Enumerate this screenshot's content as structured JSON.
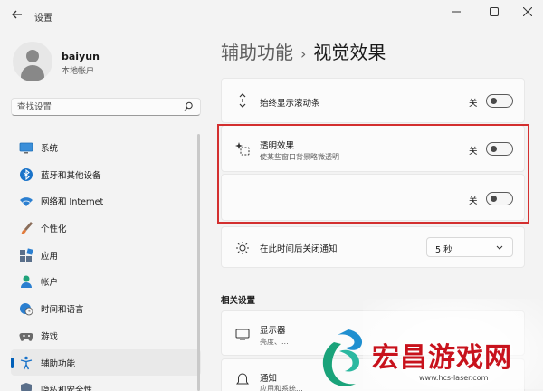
{
  "window": {
    "title": "设置",
    "back_icon": "back-arrow-icon",
    "controls": [
      "minimize-icon",
      "maximize-icon",
      "close-icon"
    ]
  },
  "profile": {
    "name": "baiyun",
    "account_type": "本地帐户"
  },
  "search": {
    "placeholder": "查找设置",
    "value": ""
  },
  "sidebar": {
    "items": [
      {
        "label": "系统",
        "icon": "monitor-icon",
        "active": false
      },
      {
        "label": "蓝牙和其他设备",
        "icon": "bluetooth-icon",
        "active": false
      },
      {
        "label": "网络和 Internet",
        "icon": "wifi-icon",
        "active": false
      },
      {
        "label": "个性化",
        "icon": "brush-icon",
        "active": false
      },
      {
        "label": "应用",
        "icon": "apps-icon",
        "active": false
      },
      {
        "label": "帐户",
        "icon": "person-icon",
        "active": false
      },
      {
        "label": "时间和语言",
        "icon": "globe-clock-icon",
        "active": false
      },
      {
        "label": "游戏",
        "icon": "gamepad-icon",
        "active": false
      },
      {
        "label": "辅助功能",
        "icon": "accessibility-icon",
        "active": true
      },
      {
        "label": "隐私和安全性",
        "icon": "shield-icon",
        "active": false
      }
    ]
  },
  "breadcrumb": {
    "parent": "辅助功能",
    "separator": "›",
    "current": "视觉效果"
  },
  "settings": {
    "scrollbars": {
      "title": "始终显示滚动条",
      "state_label": "关",
      "on": false,
      "icon": "scroll-arrows-icon"
    },
    "transparency": {
      "title": "透明效果",
      "description": "使某些窗口背景略微透明",
      "state_label": "关",
      "on": false,
      "icon": "sparkle-icon"
    },
    "animation": {
      "title": "",
      "state_label": "关",
      "on": false
    },
    "dismiss": {
      "title": "在此时间后关闭通知",
      "value": "5 秒",
      "icon": "sun-icon"
    }
  },
  "related": {
    "heading": "相关设置",
    "items": [
      {
        "title": "显示器",
        "description": "亮度、...",
        "icon": "display-icon"
      },
      {
        "title": "通知",
        "description": "应用和系统...",
        "icon": "bell-icon"
      }
    ]
  },
  "watermark": {
    "text": "宏昌游戏网",
    "url": "www.hcs-laser.com"
  },
  "colors": {
    "accent": "#005fb8",
    "highlight_border": "#d32f2f",
    "watermark_red": "#c8121c"
  }
}
